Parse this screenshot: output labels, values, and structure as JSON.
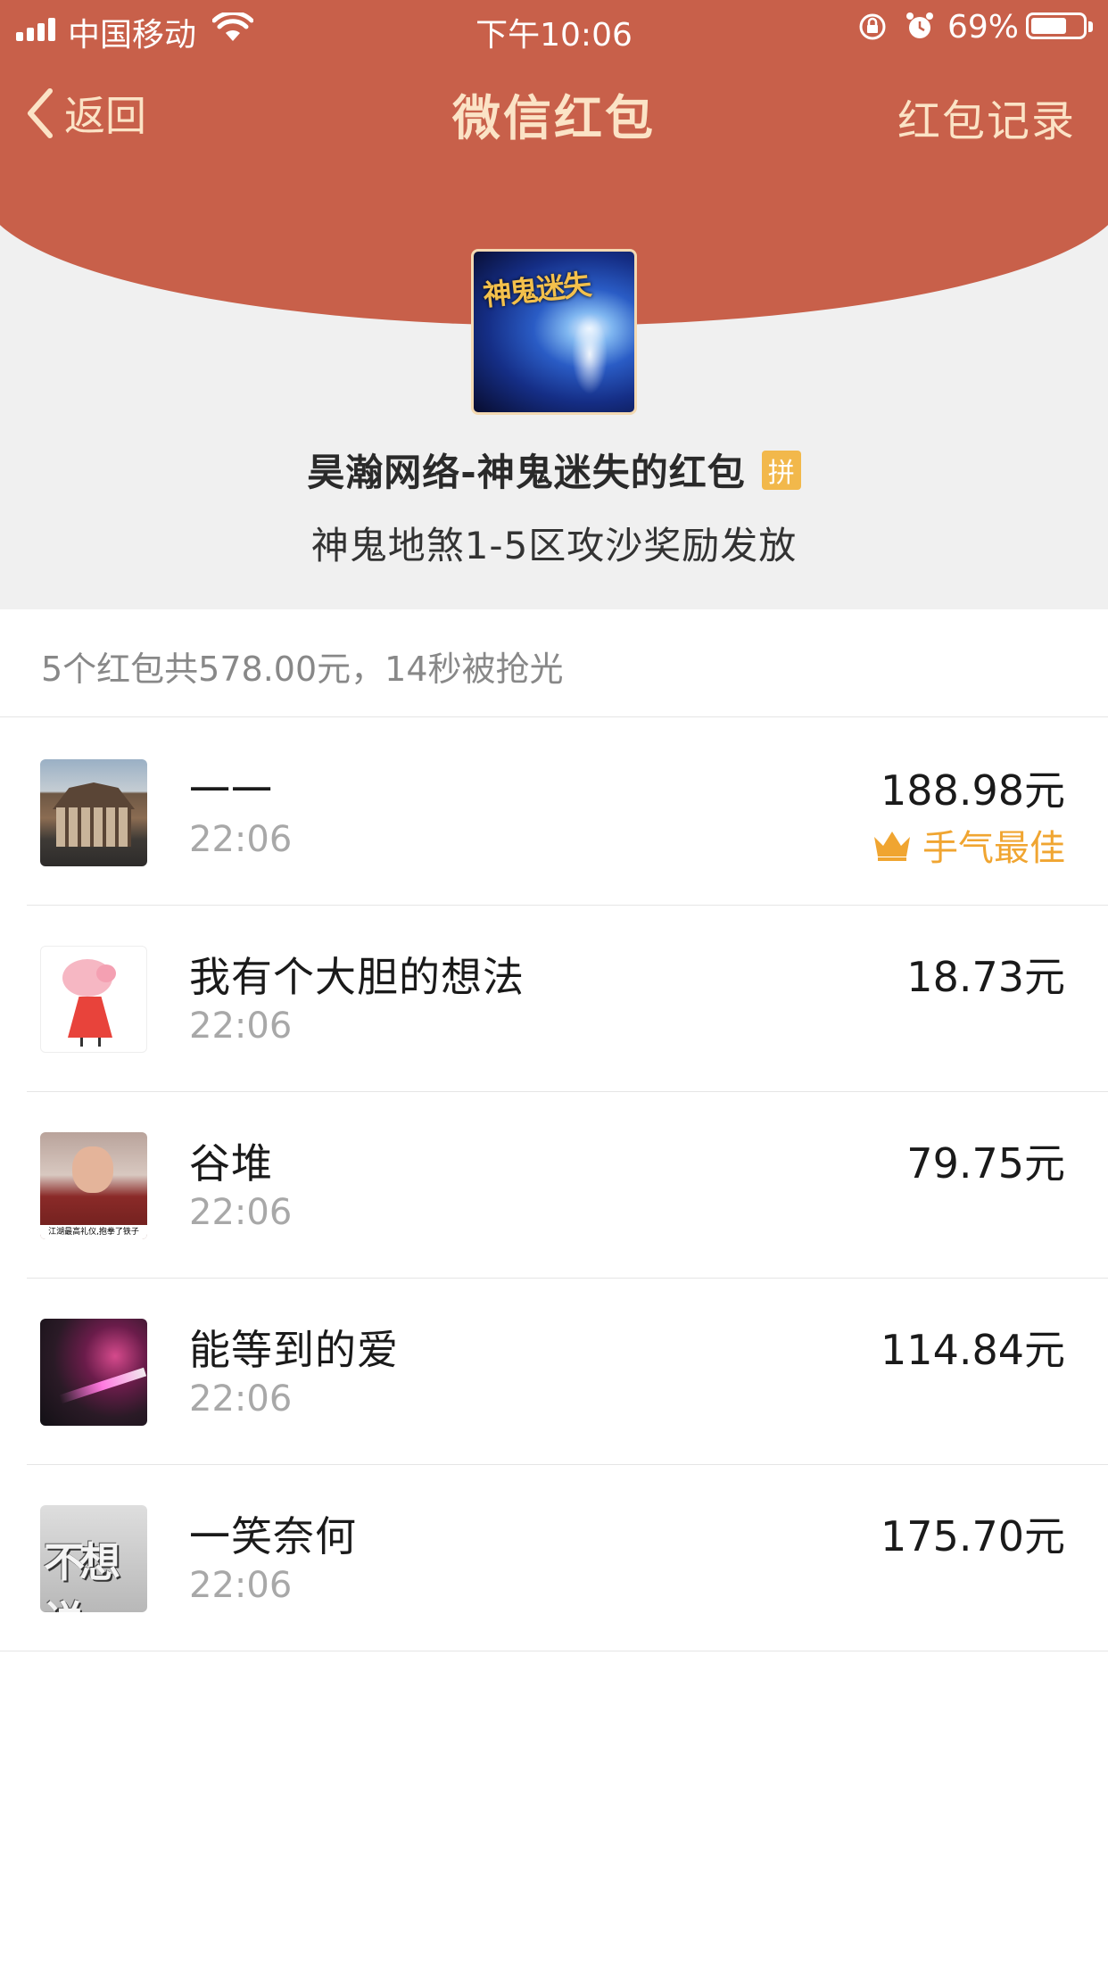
{
  "status_bar": {
    "carrier": "中国移动",
    "time": "下午10:06",
    "battery": "69%",
    "battery_level": 0.69
  },
  "nav": {
    "back_label": "返回",
    "title": "微信红包",
    "record_label": "红包记录"
  },
  "sender": {
    "avatar_text": "神鬼迷失",
    "name": "昊瀚网络-神鬼迷失的红包",
    "badge": "拼",
    "greeting": "神鬼地煞1-5区攻沙奖励发放"
  },
  "summary": "5个红包共578.00元，14秒被抢光",
  "recipients": [
    {
      "name": "一一",
      "time": "22:06",
      "amount": "188.98元",
      "best_label": "手气最佳"
    },
    {
      "name": "我有个大胆的想法",
      "time": "22:06",
      "amount": "18.73元"
    },
    {
      "name": "谷堆",
      "time": "22:06",
      "amount": "79.75元",
      "avatar_caption": "江湖最高礼仪,抱拳了铁子"
    },
    {
      "name": "能等到的爱",
      "time": "22:06",
      "amount": "114.84元"
    },
    {
      "name": "一笑奈何",
      "time": "22:06",
      "amount": "175.70元",
      "avatar_text": "不想说"
    }
  ],
  "colors": {
    "header_red": "#c8604a",
    "header_text": "#fbe3c6",
    "best_gold": "#f0a531",
    "badge": "#f2b84b"
  }
}
